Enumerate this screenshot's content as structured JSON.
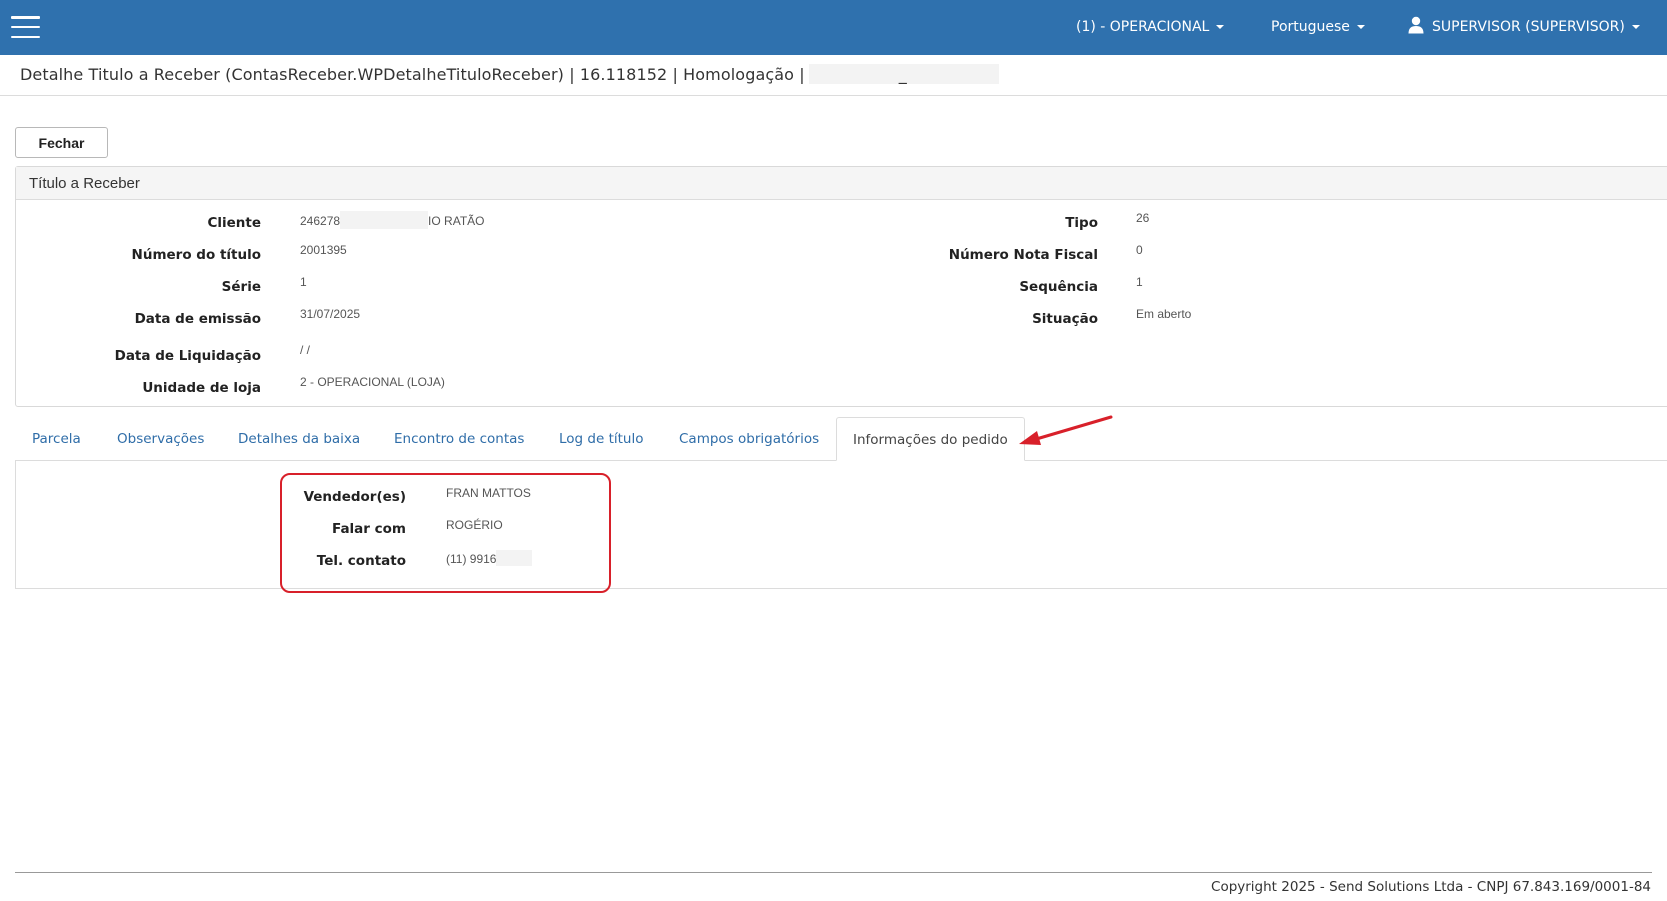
{
  "navbar": {
    "background": "#2f71ae",
    "menu_icon": "hamburger-menu-icon",
    "company": "(1) - OPERACIONAL",
    "language": "Portuguese",
    "user_icon": "user-icon",
    "user": "SUPERVISOR (SUPERVISOR)"
  },
  "page": {
    "title": "Detalhe Titulo a Receber (ContasReceber.WPDetalheTituloReceber) | 16.118152 | Homologação |",
    "title_suffix": "_"
  },
  "toolbar": {
    "close_label": "Fechar"
  },
  "panel": {
    "title": "Título a Receber",
    "fields_left": [
      {
        "label": "Cliente",
        "value_prefix": "246278",
        "value_suffix": "IO RATÃO"
      },
      {
        "label": "Número do título",
        "value": "2001395"
      },
      {
        "label": "Série",
        "value": "1"
      },
      {
        "label": "Data de emissão",
        "value": "31/07/2025"
      },
      {
        "label": "Data de Liquidação",
        "value": "/ /"
      },
      {
        "label": "Unidade de loja",
        "value": "2 - OPERACIONAL (LOJA)"
      }
    ],
    "fields_right": [
      {
        "label": "Tipo",
        "value": "26"
      },
      {
        "label": "Número Nota Fiscal",
        "value": "0"
      },
      {
        "label": "Sequência",
        "value": "1"
      },
      {
        "label": "Situação",
        "value": "Em aberto"
      }
    ]
  },
  "tabs": [
    {
      "label": "Parcela"
    },
    {
      "label": "Observações"
    },
    {
      "label": "Detalhes da baixa"
    },
    {
      "label": "Encontro de contas"
    },
    {
      "label": "Log de título"
    },
    {
      "label": "Campos obrigatórios"
    },
    {
      "label": "Informações do pedido",
      "active": true
    }
  ],
  "order_info": [
    {
      "label": "Vendedor(es)",
      "value": "FRAN MATTOS"
    },
    {
      "label": "Falar com",
      "value": "ROGÉRIO"
    },
    {
      "label": "Tel. contato",
      "value": "(11) 9916"
    }
  ],
  "annotation": {
    "color": "#d8202a"
  },
  "footer": {
    "text": "Copyright 2025 - Send Solutions Ltda - CNPJ 67.843.169/0001-84"
  }
}
